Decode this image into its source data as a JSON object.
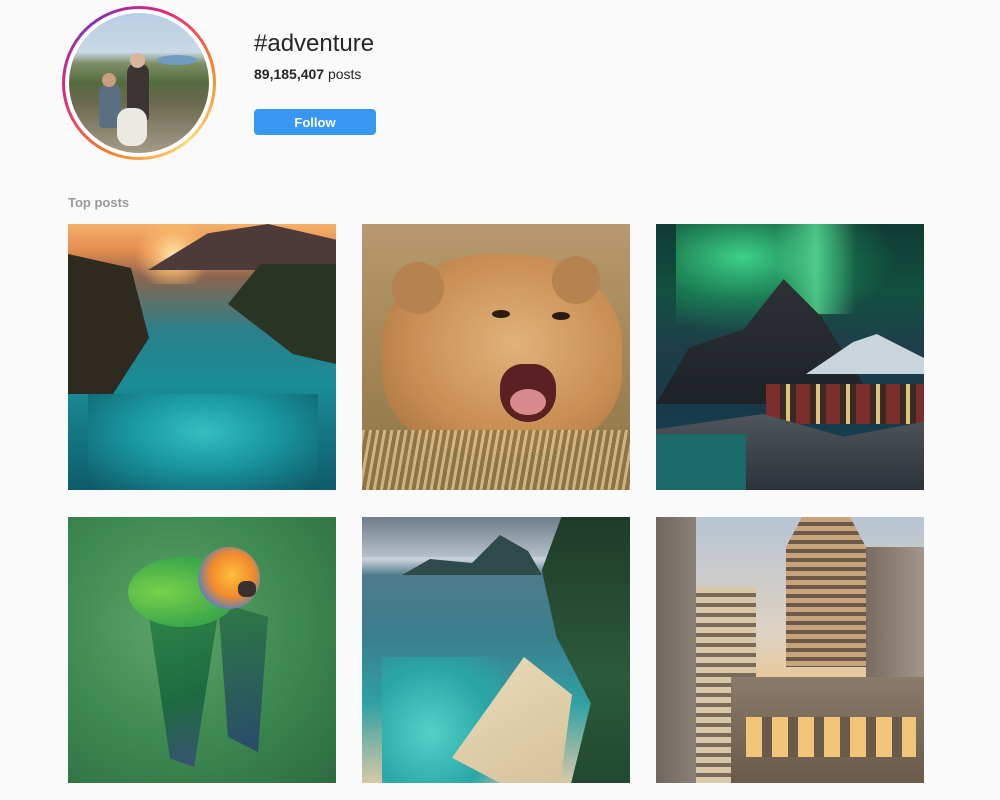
{
  "hashtag": {
    "title": "#adventure",
    "posts_count": "89,185,407",
    "posts_label": "posts",
    "follow_label": "Follow"
  },
  "section": {
    "label": "Top posts"
  },
  "colors": {
    "follow_button": "#3897f0",
    "background": "#fafafa",
    "section_label": "#999999"
  },
  "posts": [
    {
      "subject": "tropical-river-photo"
    },
    {
      "subject": "lion-cub-photo"
    },
    {
      "subject": "aurora-mountain-photo"
    },
    {
      "subject": "parrot-photo"
    },
    {
      "subject": "tropical-beach-photo"
    },
    {
      "subject": "city-buildings-photo"
    }
  ]
}
